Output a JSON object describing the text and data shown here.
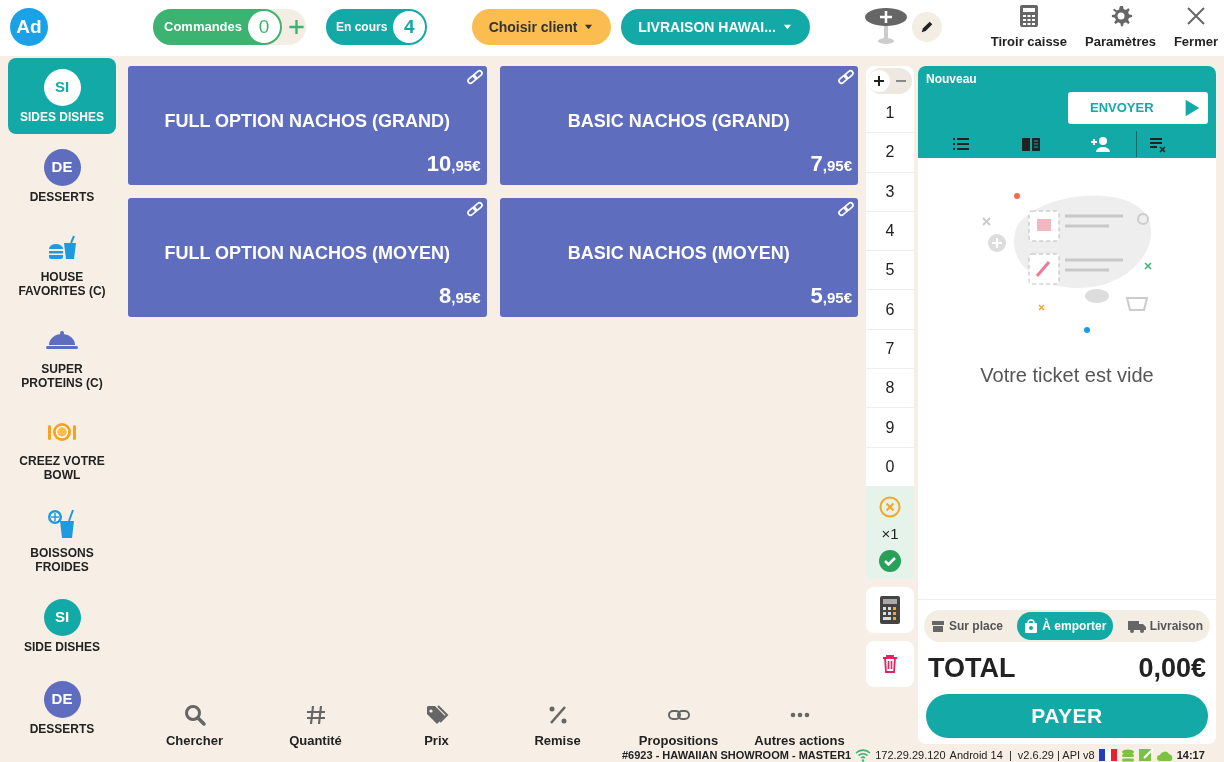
{
  "header": {
    "avatar": "Ad",
    "orders": {
      "label": "Commandes",
      "count": "0"
    },
    "in_progress": {
      "label": "En cours",
      "count": "4"
    },
    "client_button": "Choisir client",
    "channel_button": "LIVRAISON HAWAI...",
    "actions": [
      {
        "kind": "drawer",
        "label": "Tiroir caisse"
      },
      {
        "kind": "settings",
        "label": "Paramètres"
      },
      {
        "kind": "close",
        "label": "Fermer"
      }
    ]
  },
  "categories": [
    {
      "kind": "initials",
      "initials": "SI",
      "label": "SIDES DISHES",
      "color": "#13a9a6",
      "selected": true
    },
    {
      "kind": "initials",
      "initials": "DE",
      "label": "DESSERTS",
      "color": "#5f6dbf",
      "selected": false
    },
    {
      "kind": "burger",
      "label": "HOUSE FAVORITES (C)",
      "selected": false
    },
    {
      "kind": "cloche",
      "label": "SUPER PROTEINS (C)",
      "selected": false
    },
    {
      "kind": "plate",
      "label": "CREEZ VOTRE BOWL",
      "selected": false
    },
    {
      "kind": "drink",
      "label": "BOISSONS FROIDES",
      "selected": false
    },
    {
      "kind": "initials",
      "initials": "SI",
      "label": "SIDE DISHES",
      "color": "#13a9a6",
      "selected": false
    },
    {
      "kind": "initials",
      "initials": "DE",
      "label": "DESSERTS",
      "color": "#5f6dbf",
      "selected": false
    }
  ],
  "products": [
    {
      "name": "FULL OPTION NACHOS (GRAND)",
      "price": "10,95€"
    },
    {
      "name": "BASIC NACHOS (GRAND)",
      "price": "7,95€"
    },
    {
      "name": "FULL OPTION NACHOS (MOYEN)",
      "price": "8,95€"
    },
    {
      "name": "BASIC NACHOS (MOYEN)",
      "price": "5,95€"
    }
  ],
  "numpad": {
    "signs": [
      {
        "kind": "plus",
        "selected": true
      },
      {
        "kind": "minus",
        "selected": false
      }
    ],
    "keys": [
      "1",
      "2",
      "3",
      "4",
      "5",
      "6",
      "7",
      "8",
      "9",
      "0"
    ],
    "multiplier": "×1"
  },
  "ticket": {
    "title": "Nouveau",
    "send_button": "ENVOYER",
    "empty_message": "Votre ticket est vide",
    "order_types": [
      {
        "kind": "dine_in",
        "label": "Sur place",
        "selected": false
      },
      {
        "kind": "takeaway",
        "label": "À emporter",
        "selected": true
      },
      {
        "kind": "delivery",
        "label": "Livraison",
        "selected": false
      }
    ],
    "total_label": "TOTAL",
    "total": "0,00€",
    "pay_button": "PAYER"
  },
  "toolbar": [
    {
      "kind": "search",
      "label": "Chercher"
    },
    {
      "kind": "hash",
      "label": "Quantité"
    },
    {
      "kind": "tag",
      "label": "Prix"
    },
    {
      "kind": "percent",
      "label": "Remise"
    },
    {
      "kind": "link",
      "label": "Propositions"
    },
    {
      "kind": "more",
      "label": "Autres actions"
    }
  ],
  "status_bar": {
    "terminal": "#6923 - HAWAIIAN SHOWROOM - MASTER1",
    "ip": "172.29.29.120",
    "info": "Android 14  |  v2.6.29 | API v8",
    "time": "14:17"
  }
}
